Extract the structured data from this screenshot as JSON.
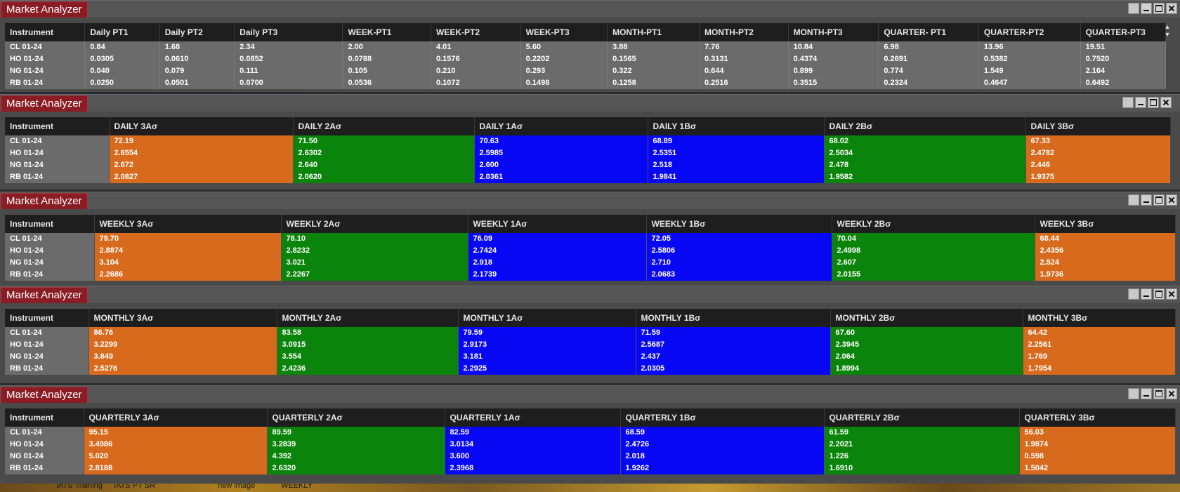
{
  "panels": [
    {
      "title": "Market Analyzer",
      "kind": "pt",
      "columns": [
        "Instrument",
        "Daily PT1",
        "Daily PT2",
        "Daily PT3",
        "WEEK-PT1",
        "WEEK-PT2",
        "WEEK-PT3",
        "MONTH-PT1",
        "MONTH-PT2",
        "MONTH-PT3",
        "QUARTER- PT1",
        "QUARTER-PT2",
        "QUARTER-PT3"
      ],
      "rows": [
        [
          "CL 01-24",
          "0.84",
          "1.68",
          "2.34",
          "2.00",
          "4.01",
          "5.60",
          "3.88",
          "7.76",
          "10.84",
          "6.98",
          "13.96",
          "19.51"
        ],
        [
          "HO 01-24",
          "0.0305",
          "0.0610",
          "0.0852",
          "0.0788",
          "0.1576",
          "0.2202",
          "0.1565",
          "0.3131",
          "0.4374",
          "0.2691",
          "0.5382",
          "0.7520"
        ],
        [
          "NG 01-24",
          "0.040",
          "0.079",
          "0.111",
          "0.105",
          "0.210",
          "0.293",
          "0.322",
          "0.644",
          "0.899",
          "0.774",
          "1.549",
          "2.164"
        ],
        [
          "RB 01-24",
          "0.0250",
          "0.0501",
          "0.0700",
          "0.0536",
          "0.1072",
          "0.1498",
          "0.1258",
          "0.2516",
          "0.3515",
          "0.2324",
          "0.4647",
          "0.6492"
        ]
      ]
    },
    {
      "title": "Market Analyzer",
      "kind": "band",
      "columns": [
        "Instrument",
        "DAILY 3Aσ",
        "DAILY 2Aσ",
        "DAILY 1Aσ",
        "DAILY 1Bσ",
        "DAILY 2Bσ",
        "DAILY 3Bσ"
      ],
      "rows": [
        [
          "CL 01-24",
          "72.19",
          "71.50",
          "70.63",
          "68.89",
          "68.02",
          "67.33"
        ],
        [
          "HO 01-24",
          "2.6554",
          "2.6302",
          "2.5985",
          "2.5351",
          "2.5034",
          "2.4782"
        ],
        [
          "NG 01-24",
          "2.672",
          "2.640",
          "2.600",
          "2.518",
          "2.478",
          "2.446"
        ],
        [
          "RB 01-24",
          "2.0827",
          "2.0620",
          "2.0361",
          "1.9841",
          "1.9582",
          "1.9375"
        ]
      ]
    },
    {
      "title": "Market Analyzer",
      "kind": "band",
      "columns": [
        "Instrument",
        "WEEKLY 3Aσ",
        "WEEKLY 2Aσ",
        "WEEKLY 1Aσ",
        "WEEKLY 1Bσ",
        "WEEKLY 2Bσ",
        "WEEKLY 3Bσ"
      ],
      "rows": [
        [
          "CL 01-24",
          "79.70",
          "78.10",
          "76.09",
          "72.05",
          "70.04",
          "68.44"
        ],
        [
          "HO 01-24",
          "2.8874",
          "2.8232",
          "2.7424",
          "2.5806",
          "2.4998",
          "2.4356"
        ],
        [
          "NG 01-24",
          "3.104",
          "3.021",
          "2.918",
          "2.710",
          "2.607",
          "2.524"
        ],
        [
          "RB 01-24",
          "2.2686",
          "2.2267",
          "2.1739",
          "2.0683",
          "2.0155",
          "1.9736"
        ]
      ]
    },
    {
      "title": "Market Analyzer",
      "kind": "band",
      "columns": [
        "Instrument",
        "MONTHLY 3Aσ",
        "MONTHLY 2Aσ",
        "MONTHLY 1Aσ",
        "MONTHLY 1Bσ",
        "MONTHLY 2Bσ",
        "MONTHLY 3Bσ"
      ],
      "rows": [
        [
          "CL 01-24",
          "86.76",
          "83.58",
          "79.59",
          "71.59",
          "67.60",
          "64.42"
        ],
        [
          "HO 01-24",
          "3.2299",
          "3.0915",
          "2.9173",
          "2.5687",
          "2.3945",
          "2.2561"
        ],
        [
          "NG 01-24",
          "3.849",
          "3.554",
          "3.181",
          "2.437",
          "2.064",
          "1.769"
        ],
        [
          "RB 01-24",
          "2.5276",
          "2.4236",
          "2.2925",
          "2.0305",
          "1.8994",
          "1.7954"
        ]
      ]
    },
    {
      "title": "Market Analyzer",
      "kind": "band",
      "columns": [
        "Instrument",
        "QUARTERLY 3Aσ",
        "QUARTERLY 2Aσ",
        "QUARTERLY 1Aσ",
        "QUARTERLY 1Bσ",
        "QUARTERLY 2Bσ",
        "QUARTERLY 3Bσ"
      ],
      "rows": [
        [
          "CL 01-24",
          "95.15",
          "89.59",
          "82.59",
          "68.59",
          "61.59",
          "56.03"
        ],
        [
          "HO 01-24",
          "3.4986",
          "3.2839",
          "3.0134",
          "2.4726",
          "2.2021",
          "1.9874"
        ],
        [
          "NG 01-24",
          "5.020",
          "4.392",
          "3.600",
          "2.018",
          "1.226",
          "0.598"
        ],
        [
          "RB 01-24",
          "2.8188",
          "2.6320",
          "2.3968",
          "1.9262",
          "1.6910",
          "1.5042"
        ]
      ]
    }
  ],
  "band_colors": {
    "A3": "#d86a1e",
    "A2": "#0b840b",
    "A1": "#0707f4",
    "B1": "#0707f4",
    "B2": "#0b840b",
    "B3": "#d86a1e"
  },
  "taskbar": {
    "items": [
      "IATS Training",
      "IATS PT SR",
      "new image",
      "WEEKLY"
    ]
  }
}
